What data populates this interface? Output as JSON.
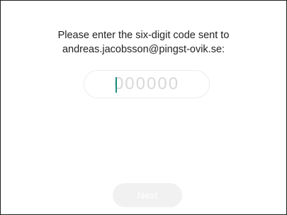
{
  "verification": {
    "prompt_line1": "Please enter the six-digit code sent to",
    "prompt_line2": "andreas.jacobsson@pingst-ovik.se:",
    "code_value": "",
    "code_placeholder": "000000",
    "next_label": "Next"
  },
  "colors": {
    "cursor": "#1f8f83",
    "button_background": "#f1f1f1",
    "field_border": "#ececec",
    "placeholder": "#d8d8d8"
  }
}
